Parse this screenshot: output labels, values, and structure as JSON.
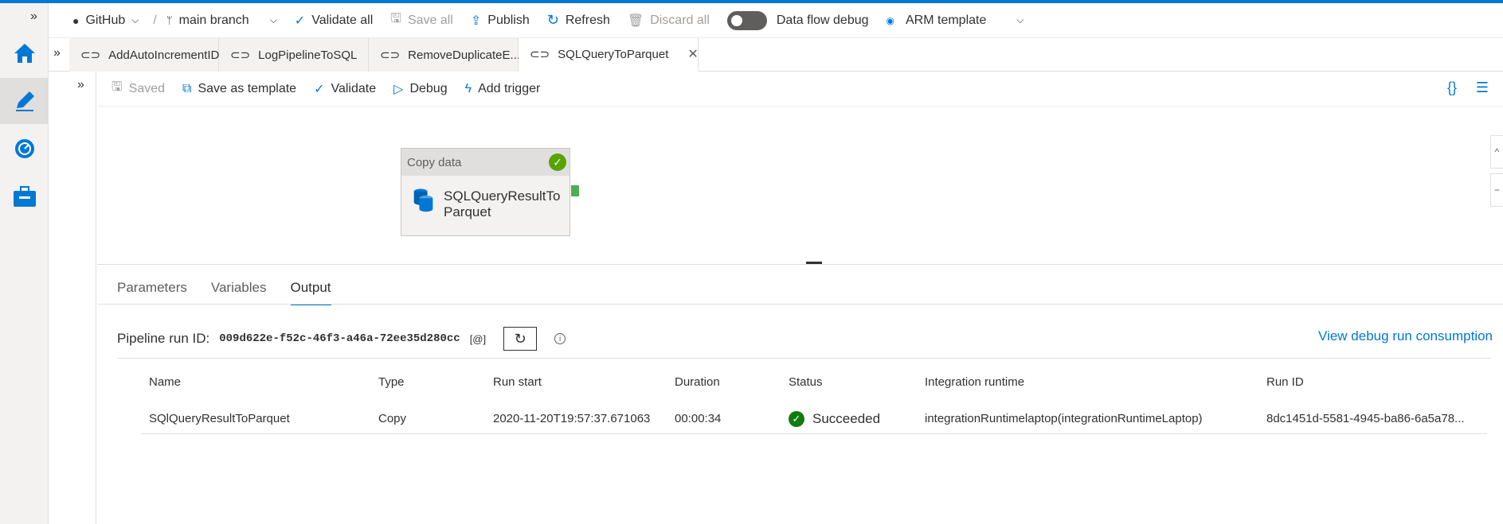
{
  "toolbar": {
    "repo_label": "GitHub",
    "separator": "/",
    "branch_label": "main branch",
    "validate_all": "Validate all",
    "save_all": "Save all",
    "publish": "Publish",
    "refresh": "Refresh",
    "discard_all": "Discard all",
    "data_flow_debug": "Data flow debug",
    "arm_template": "ARM template"
  },
  "tabs": [
    {
      "label": "AddAutoIncrementID"
    },
    {
      "label": "LogPipelineToSQL"
    },
    {
      "label": "RemoveDuplicateE..."
    },
    {
      "label": "SQLQueryToParquet"
    }
  ],
  "commands": {
    "saved": "Saved",
    "save_as_template": "Save as template",
    "validate": "Validate",
    "debug": "Debug",
    "add_trigger": "Add trigger"
  },
  "activity": {
    "type": "Copy data",
    "name": "SQLQueryResultToParquet"
  },
  "panel_tabs": {
    "parameters": "Parameters",
    "variables": "Variables",
    "output": "Output"
  },
  "pipeline_run": {
    "label": "Pipeline run ID:",
    "id": "009d622e-f52c-46f3-a46a-72ee35d280cc",
    "consumption_link": "View debug run consumption"
  },
  "table": {
    "headers": {
      "name": "Name",
      "type": "Type",
      "run_start": "Run start",
      "duration": "Duration",
      "status": "Status",
      "integration_runtime": "Integration runtime",
      "run_id": "Run ID"
    },
    "rows": [
      {
        "name": "SQlQueryResultToParquet",
        "type": "Copy",
        "run_start": "2020-11-20T19:57:37.671063",
        "duration": "00:00:34",
        "status": "Succeeded",
        "integration_runtime": "integrationRuntimelaptop(integrationRuntimeLaptop)",
        "run_id": "8dc1451d-5581-4945-ba86-6a5a78..."
      }
    ]
  },
  "colors": {
    "accent": "#0078d4",
    "success": "#107c10"
  }
}
